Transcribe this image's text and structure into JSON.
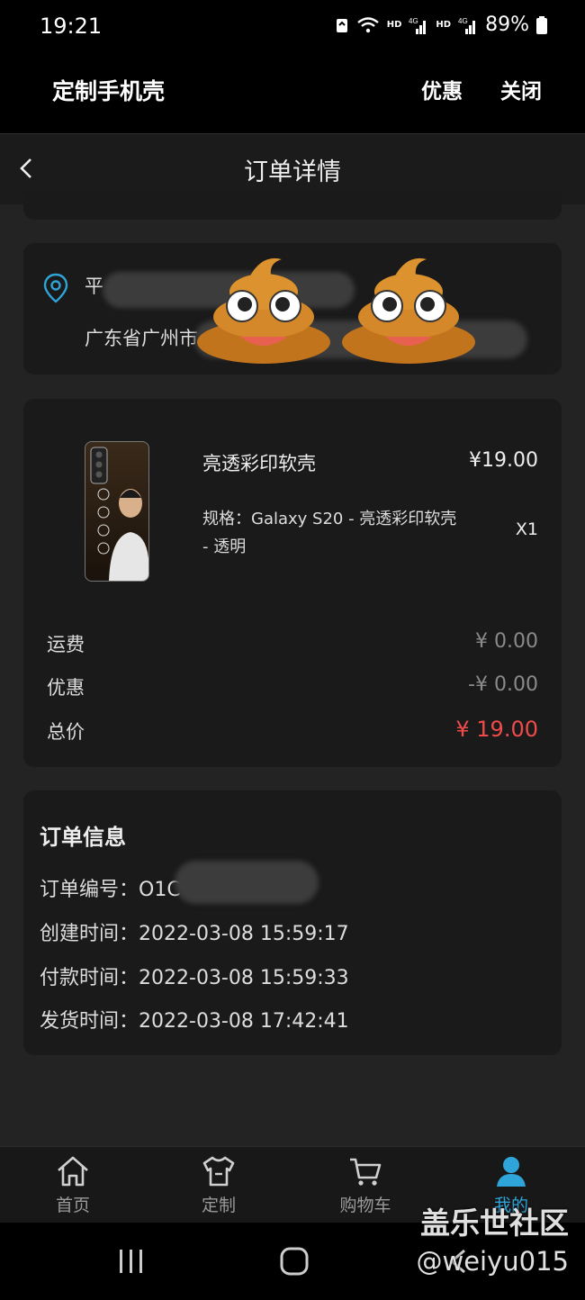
{
  "status_bar": {
    "time": "19:21",
    "battery": "89%",
    "network_label": "HD",
    "network_type": "4G"
  },
  "app_bar": {
    "title": "定制手机壳",
    "promo_label": "优惠",
    "close_label": "关闭"
  },
  "nav": {
    "title": "订单详情"
  },
  "address": {
    "name_partial": "平",
    "line_partial": "广东省广州市"
  },
  "order_item": {
    "name": "亮透彩印软壳",
    "price": "¥19.00",
    "spec": "规格：Galaxy S20 - 亮透彩印软壳 - 透明",
    "qty": "X1"
  },
  "summary": {
    "shipping_label": "运费",
    "shipping_value": "¥ 0.00",
    "discount_label": "优惠",
    "discount_value": "-¥ 0.00",
    "total_label": "总价",
    "total_value": "¥ 19.00"
  },
  "order_info": {
    "title": "订单信息",
    "rows": [
      {
        "label": "订单编号：",
        "value": "O1C"
      },
      {
        "label": "创建时间：",
        "value": "2022-03-08 15:59:17"
      },
      {
        "label": "付款时间：",
        "value": "2022-03-08 15:59:33"
      },
      {
        "label": "发货时间：",
        "value": "2022-03-08 17:42:41"
      }
    ]
  },
  "tabs": [
    {
      "label": "首页",
      "icon": "home-icon"
    },
    {
      "label": "定制",
      "icon": "shirt-icon"
    },
    {
      "label": "购物车",
      "icon": "cart-icon"
    },
    {
      "label": "我的",
      "icon": "user-icon",
      "active": true
    }
  ],
  "watermark": {
    "line1": "盖乐世社区",
    "line2": "@weiyu015"
  },
  "colors": {
    "accent": "#2fa4d8",
    "price_red": "#f04b4b",
    "background": "#232323",
    "card": "#1a1a1a"
  }
}
